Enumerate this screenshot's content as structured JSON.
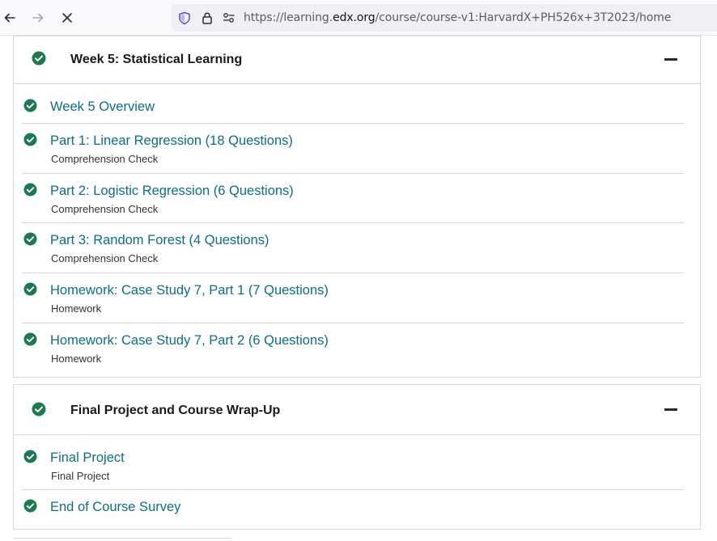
{
  "browser": {
    "url_prefix": "https://learning.",
    "url_domain": "edx.org",
    "url_path": "/course/course-v1:HarvardX+PH526x+3T2023/home"
  },
  "sections": [
    {
      "title": "Week 5: Statistical Learning",
      "items": [
        {
          "title": "Week 5 Overview",
          "subtitle": ""
        },
        {
          "title": "Part 1: Linear Regression (18 Questions)",
          "subtitle": "Comprehension Check"
        },
        {
          "title": "Part 2: Logistic Regression (6 Questions)",
          "subtitle": "Comprehension Check"
        },
        {
          "title": "Part 3: Random Forest (4 Questions)",
          "subtitle": "Comprehension Check"
        },
        {
          "title": "Homework: Case Study 7, Part 1 (7 Questions)",
          "subtitle": "Homework"
        },
        {
          "title": "Homework: Case Study 7, Part 2 (6 Questions)",
          "subtitle": "Homework"
        }
      ]
    },
    {
      "title": "Final Project and Course Wrap-Up",
      "items": [
        {
          "title": "Final Project",
          "subtitle": "Final Project"
        },
        {
          "title": "End of Course Survey",
          "subtitle": ""
        }
      ]
    }
  ],
  "colors": {
    "check_green": "#1b7a52",
    "link_teal": "#0a6e88"
  }
}
